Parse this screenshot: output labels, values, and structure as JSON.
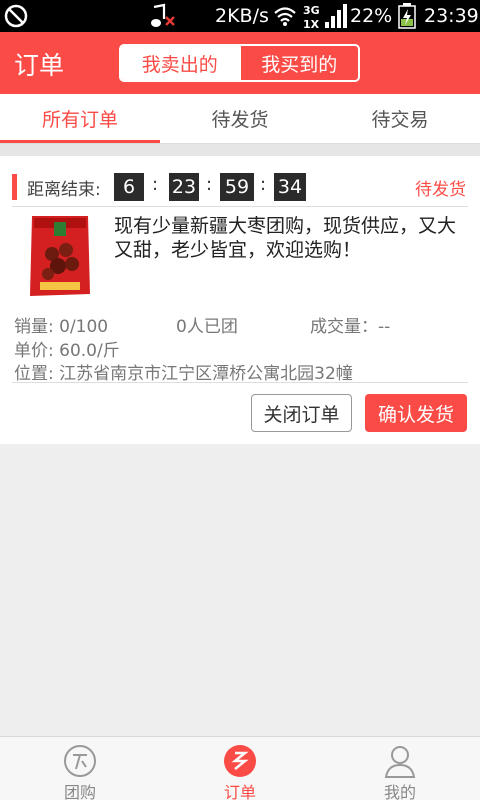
{
  "status_bar": {
    "net_speed": "2KB/s",
    "battery_percent": "22%",
    "time": "23:39",
    "icons": [
      "blocked-icon",
      "music-muted-icon",
      "wifi-icon",
      "signal-icon",
      "battery-charging-icon"
    ]
  },
  "header": {
    "title": "订单",
    "segments": [
      "我卖出的",
      "我买到的"
    ],
    "active_segment": "我卖出的"
  },
  "tabs": {
    "items": [
      "所有订单",
      "待发货",
      "待交易"
    ],
    "active": "所有订单"
  },
  "order": {
    "countdown_label": "距离结束:",
    "countdown": [
      "6",
      "23",
      "59",
      "34"
    ],
    "status": "待发货",
    "description": "现有少量新疆大枣团购，现货供应，又大又甜，老少皆宜，欢迎选购！",
    "sales": "销量: 0/100",
    "joined": "0人已团",
    "deal_volume": "成交量：--",
    "unit_price": "单价: 60.0/斤",
    "location": "位置: 江苏省南京市江宁区潭桥公寓北园32幢",
    "close_button": "关闭订单",
    "confirm_button": "确认发货"
  },
  "bottom_nav": {
    "items": [
      {
        "label": "团购",
        "icon": "group-buy-icon"
      },
      {
        "label": "订单",
        "icon": "orders-icon"
      },
      {
        "label": "我的",
        "icon": "profile-icon"
      }
    ],
    "active": "订单"
  },
  "colors": {
    "accent": "#fb4b46",
    "background": "#eeeeee"
  }
}
